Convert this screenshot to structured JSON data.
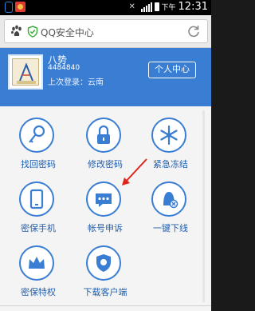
{
  "status_bar": {
    "ampm": "下午",
    "time": "12:31",
    "icons": [
      "app-icon",
      "notification-icon",
      "mute-icon",
      "signal-icon",
      "battery-icon"
    ]
  },
  "browser": {
    "page_title": "QQ安全中心",
    "icons": [
      "baidu-paw-icon",
      "security-shield-icon",
      "refresh-icon"
    ]
  },
  "profile": {
    "name": "八势",
    "qq_number": "4484840",
    "last_login": "上次登录：云南",
    "center_button": "个人中心"
  },
  "tiles": [
    {
      "label": "找回密码",
      "icon": "key-icon"
    },
    {
      "label": "修改密码",
      "icon": "lock-icon"
    },
    {
      "label": "紧急冻结",
      "icon": "snowflake-icon"
    },
    {
      "label": "密保手机",
      "icon": "phone-icon"
    },
    {
      "label": "帐号申诉",
      "icon": "chat-bubble-icon"
    },
    {
      "label": "一键下线",
      "icon": "user-offline-icon"
    },
    {
      "label": "密保特权",
      "icon": "crown-icon"
    },
    {
      "label": "下载客户端",
      "icon": "shield-icon"
    }
  ],
  "colors": {
    "brand_blue": "#3a7ed4",
    "label_blue": "#1f5fb0",
    "annotation_arrow": "#e0241b"
  }
}
